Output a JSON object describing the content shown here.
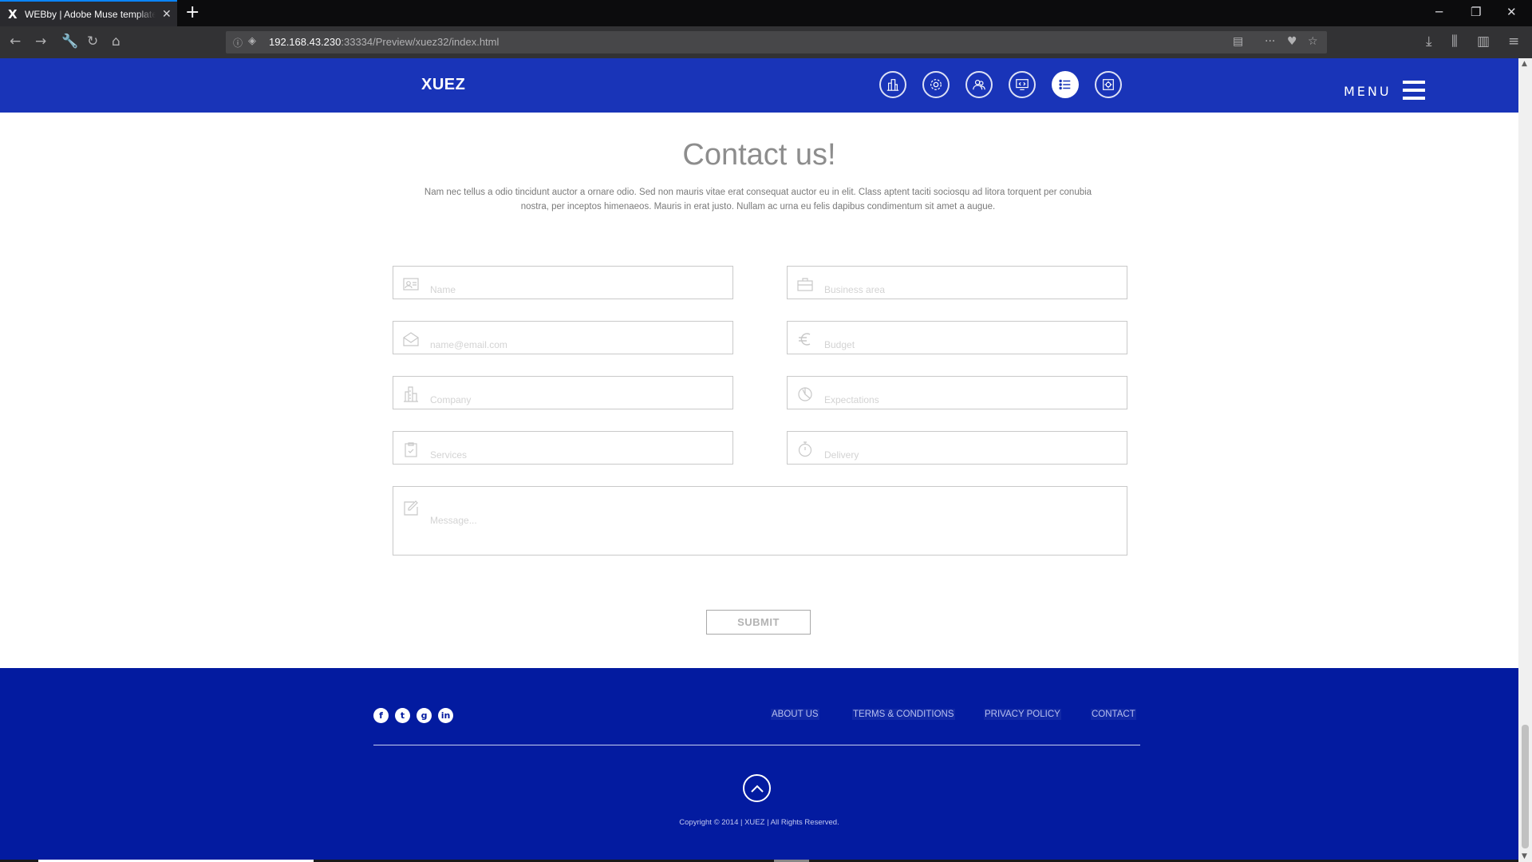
{
  "browser": {
    "tab_title": "WEBby | Adobe Muse template",
    "tab_favicon": "X",
    "url_host": "192.168.43.230",
    "url_rest": ":33334/Preview/xuez32/index.html"
  },
  "site": {
    "logo": "XUEZ",
    "menu_label": "MENU",
    "header_icons": [
      "building-icon",
      "gear-icon",
      "users-icon",
      "monitor-code-icon",
      "list-icon",
      "settings-panel-icon"
    ],
    "header_active_icon": "list-icon",
    "brand_color": "#1934b8",
    "footer_color": "#031ba0"
  },
  "contact": {
    "title": "Contact us!",
    "text_line1": "Nam nec tellus a odio tincidunt auctor a ornare odio. Sed non  mauris vitae erat consequat auctor eu in elit. Class aptent taciti sociosqu ad litora torquent per conubia",
    "text_line2": "nostra, per inceptos himenaeos. Mauris in erat justo. Nullam ac urna eu felis dapibus condimentum sit amet a augue.",
    "fields": {
      "name": "Name",
      "business": "Business area",
      "email": "name@email.com",
      "budget": "Budget",
      "company": "Company",
      "expectations": "Expectations",
      "services": "Services",
      "delivery": "Delivery",
      "message": "Message..."
    },
    "submit": "SUBMIT"
  },
  "footer": {
    "social_icons": [
      "facebook-icon",
      "twitter-icon",
      "google-plus-icon",
      "linkedin-icon"
    ],
    "links": {
      "about": "ABOUT US",
      "terms": "TERMS & CONDITIONS",
      "privacy": "PRIVACY POLICY",
      "contact": "CONTACT"
    },
    "copyright": "Copyright © 2014 | XUEZ | All Rights Reserved."
  }
}
